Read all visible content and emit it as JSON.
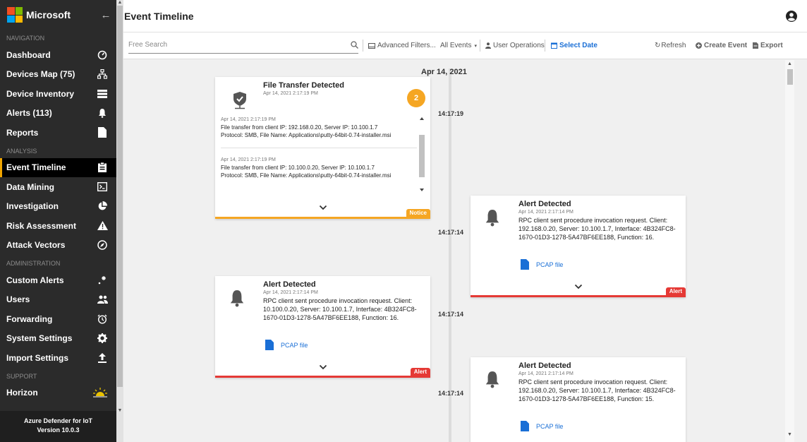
{
  "brand": {
    "name": "Microsoft",
    "collapse_icon": "arrow-left-icon"
  },
  "sidebar": {
    "sections": [
      {
        "title": "NAVIGATION",
        "items": [
          {
            "label": "Dashboard",
            "icon": "gauge-icon"
          },
          {
            "label": "Devices Map (75)",
            "icon": "sitemap-icon"
          },
          {
            "label": "Device Inventory",
            "icon": "list-icon"
          },
          {
            "label": "Alerts (113)",
            "icon": "bell-icon"
          },
          {
            "label": "Reports",
            "icon": "file-icon"
          }
        ]
      },
      {
        "title": "ANALYSIS",
        "items": [
          {
            "label": "Event Timeline",
            "icon": "clipboard-icon",
            "active": true
          },
          {
            "label": "Data Mining",
            "icon": "terminal-icon"
          },
          {
            "label": "Investigation",
            "icon": "pie-icon"
          },
          {
            "label": "Risk Assessment",
            "icon": "warning-icon"
          },
          {
            "label": "Attack Vectors",
            "icon": "compass-icon"
          }
        ]
      },
      {
        "title": "ADMINISTRATION",
        "items": [
          {
            "label": "Custom Alerts",
            "icon": "sparkle-icon"
          },
          {
            "label": "Users",
            "icon": "users-icon"
          },
          {
            "label": "Forwarding",
            "icon": "clock-icon"
          },
          {
            "label": "System Settings",
            "icon": "gear-icon"
          },
          {
            "label": "Import Settings",
            "icon": "upload-icon"
          }
        ]
      },
      {
        "title": "SUPPORT",
        "items": [
          {
            "label": "Horizon",
            "icon": "horizon-icon"
          }
        ]
      }
    ],
    "footer": {
      "line1": "Azure Defender for IoT",
      "line2": "Version 10.0.3"
    }
  },
  "header": {
    "title": "Event Timeline"
  },
  "toolbar": {
    "search_placeholder": "Free Search",
    "advanced_filters": "Advanced Filters...",
    "all_events": "All Events",
    "user_operations": "User Operations",
    "select_date": "Select Date",
    "refresh": "Refresh",
    "create_event": "Create Event",
    "export": "Export"
  },
  "timeline": {
    "date": "Apr 14, 2021",
    "times": [
      "14:17:19",
      "14:17:14",
      "14:17:14",
      "14:17:14"
    ],
    "events": [
      {
        "title": "File Transfer Detected",
        "time": "Apr 14, 2021 2:17:19 PM",
        "badge": "2",
        "tag": "Notice",
        "logs": [
          {
            "time": "Apr 14, 2021 2:17:19 PM",
            "line1": "File transfer from client IP: 192.168.0.20, Server IP: 10.100.1.7",
            "line2": "Protocol: SMB, File Name: Applications\\putty-64bit-0.74-installer.msi"
          },
          {
            "time": "Apr 14, 2021 2:17:19 PM",
            "line1": "File transfer from client IP: 10.100.0.20, Server IP: 10.100.1.7",
            "line2": "Protocol: SMB, File Name: Applications\\putty-64bit-0.74-installer.msi"
          }
        ]
      },
      {
        "title": "Alert Detected",
        "time": "Apr 14, 2021 2:17:14 PM",
        "desc": "RPC client sent procedure invocation request. Client: 192.168.0.20, Server: 10.100.1.7, Interface: 4B324FC8-1670-01D3-1278-5A47BF6EE188, Function: 16.",
        "pcap": "PCAP file",
        "tag": "Alert"
      },
      {
        "title": "Alert Detected",
        "time": "Apr 14, 2021 2:17:14 PM",
        "desc": "RPC client sent procedure invocation request. Client: 10.100.0.20, Server: 10.100.1.7, Interface: 4B324FC8-1670-01D3-1278-5A47BF6EE188, Function: 16.",
        "pcap": "PCAP file",
        "tag": "Alert"
      },
      {
        "title": "Alert Detected",
        "time": "Apr 14, 2021 2:17:14 PM",
        "desc": "RPC client sent procedure invocation request. Client: 192.168.0.20, Server: 10.100.1.7, Interface: 4B324FC8-1670-01D3-1278-5A47BF6EE188, Function: 15.",
        "pcap": "PCAP file"
      }
    ]
  },
  "colors": {
    "notice": "#f5a623",
    "alert": "#e53935",
    "link": "#1a6fd6",
    "accent": "#f0a500"
  }
}
